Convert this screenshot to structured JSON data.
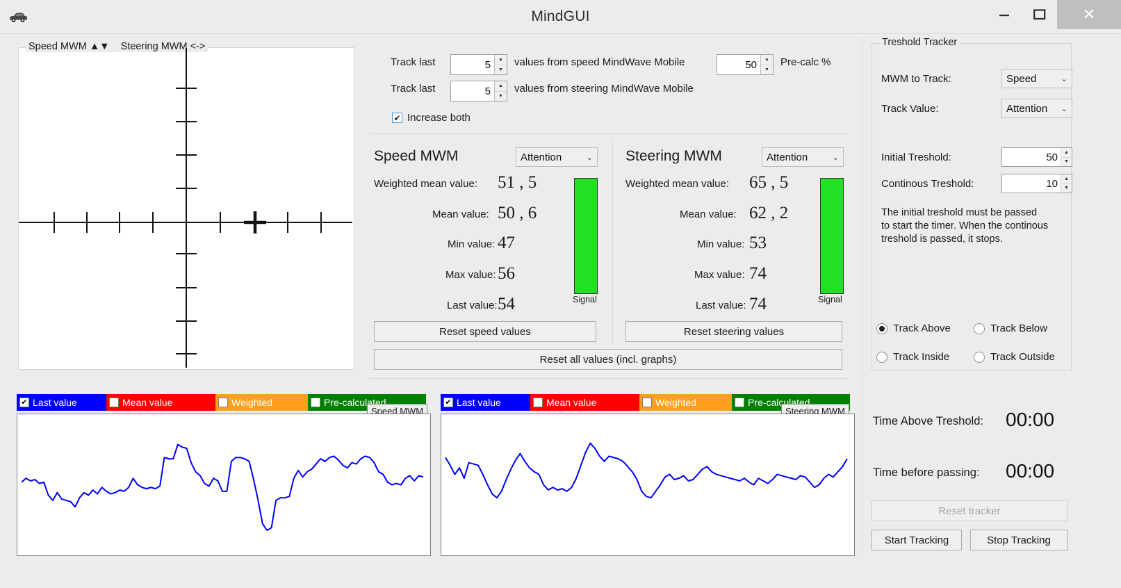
{
  "window": {
    "title": "MindGUI",
    "app_icon": "car-icon",
    "minimize": "minimize-icon",
    "maximize": "maximize-icon",
    "close": "✕"
  },
  "xy_panel": {
    "title": "Speed MWM ▲▼   Steering MWM <->",
    "title_speed": "Speed MWM ▲▼",
    "title_steering": "Steering MWM <->",
    "marker_x_ticks": 1.5,
    "marker_y_ticks": 0
  },
  "tracking_config": {
    "speed_row": {
      "prefix": "Track last",
      "value": "5",
      "suffix": "values from speed MindWave Mobile"
    },
    "steering_row": {
      "prefix": "Track last",
      "value": "5",
      "suffix": "values from steering MindWave Mobile"
    },
    "precalc": {
      "value": "50",
      "label": "Pre-calc %"
    },
    "increase_both": {
      "label": "Increase both",
      "checked": true,
      "mark": "✔"
    }
  },
  "speed_panel": {
    "heading": "Speed MWM",
    "mode": "Attention",
    "rows": [
      {
        "label": "Weighted mean value:",
        "value": "51 , 5"
      },
      {
        "label": "Mean value:",
        "value": "50 , 6"
      },
      {
        "label": "Min value:",
        "value": "47"
      },
      {
        "label": "Max value:",
        "value": "56"
      },
      {
        "label": "Last value:",
        "value": "54"
      }
    ],
    "signal_caption": "Signal",
    "signal_color": "#22e022",
    "reset_button": "Reset speed values"
  },
  "steering_panel": {
    "heading": "Steering MWM",
    "mode": "Attention",
    "rows": [
      {
        "label": "Weighted mean value:",
        "value": "65 , 5"
      },
      {
        "label": "Mean value:",
        "value": "62 , 2"
      },
      {
        "label": "Min value:",
        "value": "53"
      },
      {
        "label": "Max value:",
        "value": "74"
      },
      {
        "label": "Last value:",
        "value": "74"
      }
    ],
    "signal_caption": "Signal",
    "signal_color": "#22e022",
    "reset_button": "Reset steering values"
  },
  "reset_all_button": "Reset all values (incl. graphs)",
  "threshold_tracker": {
    "group_title": "Treshold Tracker",
    "mwm_to_track": {
      "label": "MWM to Track:",
      "value": "Speed"
    },
    "track_value": {
      "label": "Track Value:",
      "value": "Attention"
    },
    "initial_threshold": {
      "label": "Initial Treshold:",
      "value": "50"
    },
    "continuous_threshold": {
      "label": "Continous Treshold:",
      "value": "10"
    },
    "description": "The initial treshold must be passed to start the timer. When the continous treshold is passed, it stops.",
    "description_lines": [
      "The initial treshold must be passed",
      "to start the timer. When the continous",
      "treshold is passed, it stops."
    ],
    "radios": [
      {
        "label": "Track Above",
        "selected": true
      },
      {
        "label": "Track Below",
        "selected": false
      },
      {
        "label": "Track Inside",
        "selected": false
      },
      {
        "label": "Track Outside",
        "selected": false
      }
    ]
  },
  "timers": {
    "time_above": {
      "label": "Time Above Treshold:",
      "value": "00:00"
    },
    "time_before": {
      "label": "Time before passing:",
      "value": "00:00"
    },
    "reset_tracker": {
      "label": "Reset tracker",
      "enabled": false
    },
    "start_tracking": "Start Tracking",
    "stop_tracking": "Stop Tracking"
  },
  "legend_series": [
    {
      "label": "Last value",
      "color": "#0000ff",
      "checked": true,
      "mark": "✔"
    },
    {
      "label": "Mean value",
      "color": "#ff0000",
      "checked": false,
      "mark": ""
    },
    {
      "label": "Weighted",
      "color": "#ff9f1a",
      "checked": false,
      "mark": ""
    },
    {
      "label": "Pre-calculated",
      "color": "#008000",
      "checked": false,
      "mark": ""
    }
  ],
  "chart_data": [
    {
      "type": "line",
      "title": "Speed MWM",
      "tag": "Speed MWM",
      "series_name": "Last value",
      "color": "#0000ff",
      "xlabel": "",
      "ylabel": "",
      "ylim": [
        0,
        100
      ],
      "grid": false,
      "legend_position": "top",
      "values": [
        52,
        55,
        53,
        54,
        51,
        52,
        42,
        38,
        44,
        39,
        38,
        37,
        33,
        40,
        44,
        42,
        46,
        43,
        48,
        45,
        43,
        44,
        46,
        45,
        48,
        55,
        50,
        48,
        47,
        48,
        47,
        49,
        71,
        70,
        70,
        81,
        79,
        78,
        67,
        60,
        57,
        51,
        49,
        55,
        53,
        45,
        45,
        68,
        71,
        71,
        70,
        68,
        54,
        38,
        20,
        15,
        17,
        38,
        40,
        40,
        41,
        55,
        61,
        56,
        60,
        62,
        66,
        70,
        68,
        71,
        72,
        69,
        65,
        63,
        67,
        66,
        70,
        72,
        71,
        67,
        60,
        58,
        52,
        50,
        51,
        50,
        55,
        57,
        53,
        57,
        56
      ]
    },
    {
      "type": "line",
      "title": "Steering MWM",
      "tag": "Steering MWM",
      "series_name": "Last value",
      "color": "#0000ff",
      "xlabel": "",
      "ylabel": "",
      "ylim": [
        0,
        100
      ],
      "grid": false,
      "legend_position": "top",
      "values": [
        71,
        65,
        58,
        63,
        55,
        67,
        66,
        65,
        58,
        50,
        43,
        40,
        45,
        54,
        62,
        69,
        74,
        68,
        63,
        60,
        58,
        50,
        46,
        48,
        46,
        47,
        45,
        48,
        55,
        65,
        75,
        82,
        78,
        72,
        68,
        72,
        71,
        70,
        68,
        64,
        60,
        54,
        45,
        41,
        40,
        45,
        50,
        56,
        58,
        54,
        55,
        57,
        53,
        54,
        58,
        62,
        64,
        60,
        58,
        57,
        56,
        55,
        54,
        53,
        55,
        52,
        50,
        55,
        53,
        51,
        54,
        58,
        57,
        56,
        55,
        54,
        57,
        56,
        52,
        48,
        50,
        55,
        58,
        56,
        60,
        64,
        70
      ]
    }
  ]
}
